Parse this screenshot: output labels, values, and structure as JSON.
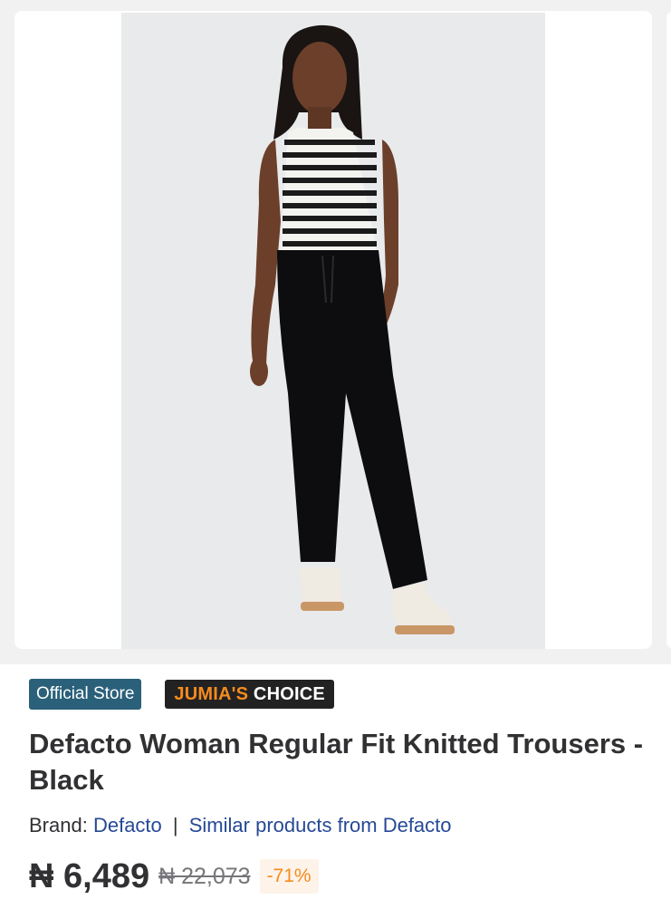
{
  "gallery": {
    "image_alt": "Defacto Woman Regular Fit Knitted Trousers - Black"
  },
  "badges": {
    "official_store": "Official Store",
    "choice_part1": "JUMIA'S",
    "choice_part2": "CHOICE"
  },
  "product": {
    "title": "Defacto Woman Regular Fit Knitted Trousers - Black",
    "brand_label": "Brand:",
    "brand_name": "Defacto",
    "separator": "|",
    "similar_link": "Similar products from Defacto"
  },
  "price": {
    "current": "₦ 6,489",
    "old": "₦ 22,073",
    "discount": "-71%"
  },
  "colors": {
    "accent_orange": "#f68b1e",
    "official_store_bg": "#2a6079",
    "link_blue": "#264996"
  }
}
